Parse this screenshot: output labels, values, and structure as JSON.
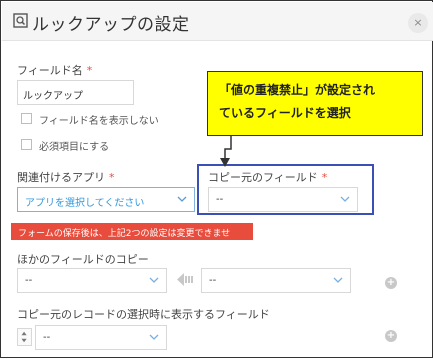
{
  "dialog": {
    "title": "ルックアップの設定",
    "close_glyph": "×"
  },
  "field_name": {
    "label": "フィールド名",
    "required_mark": "*",
    "value": "ルックアップ",
    "hide_name_label": "フィールド名を表示しない",
    "required_item_label": "必須項目にする"
  },
  "related_app": {
    "label": "関連付けるアプリ",
    "required_mark": "*",
    "placeholder": "アプリを選択してください"
  },
  "source_field": {
    "label": "コピー元のフィールド",
    "required_mark": "*",
    "value": "--"
  },
  "error_message": "フォームの保存後は、上記2つの設定は変更できません。",
  "other_copy": {
    "label": "ほかのフィールドのコピー",
    "left_value": "--",
    "right_value": "--"
  },
  "display_fields": {
    "label": "コピー元のレコードの選択時に表示するフィールド",
    "value": "--"
  },
  "callout": {
    "line1": "「値の重複禁止」が設定され",
    "line2": "ているフィールドを選択"
  },
  "colors": {
    "required": "#e74c3c",
    "error_bg": "#e74c3c",
    "callout_bg": "#ffff00",
    "highlight_border": "#3b4fb5",
    "link_blue": "#3498db"
  }
}
